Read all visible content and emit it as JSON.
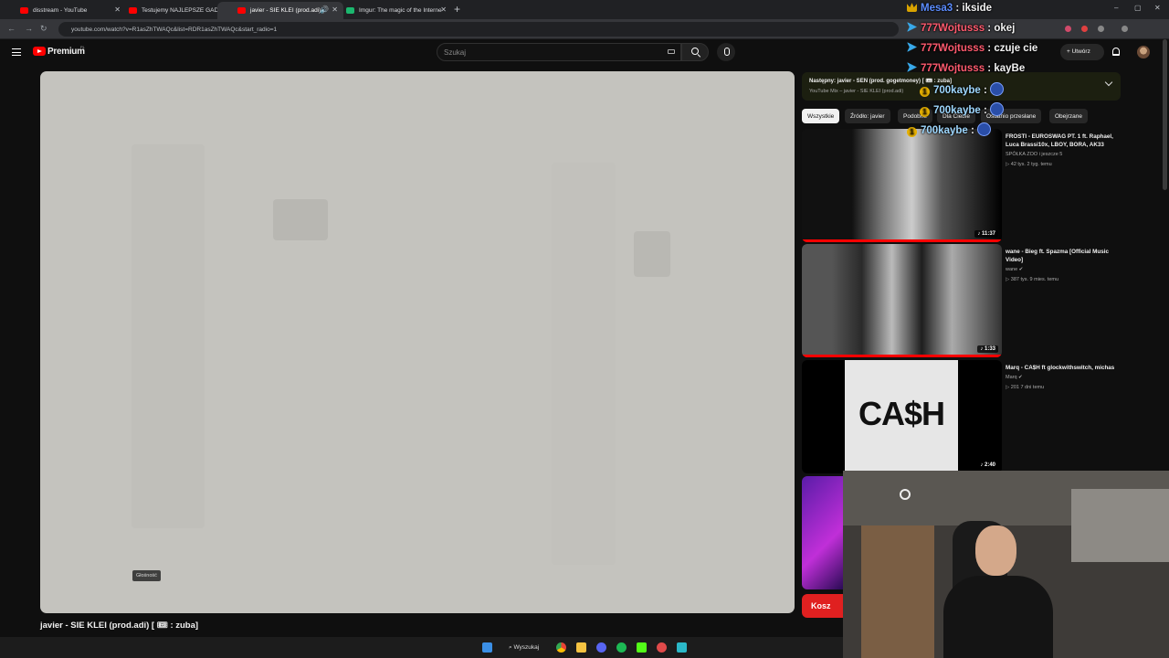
{
  "browser": {
    "tabs": [
      {
        "title": "disstream - YouTube",
        "active": false
      },
      {
        "title": "Testujemy NAJLEPSZE GADŻET",
        "active": false
      },
      {
        "title": "javier - SIE KLEI (prod.adi) | ",
        "active": true
      },
      {
        "title": "Imgur: The magic of the Interne",
        "active": false
      }
    ],
    "url": "youtube.com/watch?v=R1asZhTWAQc&list=RDR1asZhTWAQc&start_radio=1"
  },
  "youtube": {
    "logo_text": "Premium",
    "logo_region": "PL",
    "search_placeholder": "Szukaj",
    "create_label": "+ Utwórz"
  },
  "player": {
    "volume_tooltip": "Głośność",
    "video_title": "javier - SIE KLEI (prod.adi) [ 🎟 : zuba]"
  },
  "up_next": {
    "line1": "Następny: javier - SEN (prod. gogetmoney) [ 🎟 : zuba]",
    "line2": "YouTube Mix – javier - SIE KLEI (prod.adi)"
  },
  "chips": [
    "Wszystkie",
    "Źródło: javier",
    "Podobne",
    "Dla Ciebie",
    "Ostatnio przesłane",
    "Obejrzane"
  ],
  "recommendations": [
    {
      "title": "FROSTI - EUROSWAG PT. 1 ft. Raphael, Luca Brassi10x, LBOY, BORA, AK33",
      "channel": "SPÓŁKA ZOO i jeszcze 5",
      "meta": "▷ 42 tys.   2 tyg. temu",
      "duration": "♪ 11:37"
    },
    {
      "title": "wane - Bieg ft. Spazma [Official Music Video]",
      "channel": "wane ✔",
      "meta": "▷ 387 tys.   9 mies. temu",
      "duration": "♪ 1:33"
    },
    {
      "title": "Marq - CA$H ft glockwithswitch, michas",
      "channel": "Marq ✔",
      "meta": "▷ 201   7 dni temu",
      "duration": "♪ 2:40",
      "thumb_text": "CA$H"
    }
  ],
  "shop_chip": "Kosz",
  "chat": [
    {
      "user": "Mesa3",
      "message": "ikside",
      "color": "#5b8cff",
      "badge": "crown"
    },
    {
      "user": "777Wojtusss",
      "message": "okej",
      "color": "#ff5a6e",
      "badge": "prime"
    },
    {
      "user": "777Wojtusss",
      "message": "czuje cie",
      "color": "#ff5a6e",
      "badge": "prime"
    },
    {
      "user": "777Wojtusss",
      "message": "kayBe",
      "color": "#ff5a6e",
      "badge": "prime"
    },
    {
      "user": "700kaybe",
      "message": "",
      "color": "#9fd8ff",
      "badge": "coin"
    },
    {
      "user": "700kaybe",
      "message": "",
      "color": "#9fd8ff",
      "badge": "coin"
    },
    {
      "user": "700kaybe",
      "message": "",
      "color": "#9fd8ff",
      "badge": "coin"
    }
  ],
  "taskbar": {
    "search_label": "Wyszukaj"
  },
  "icons": [
    "youtube-icon",
    "speaker-icon",
    "close-icon",
    "plus-icon",
    "back-icon",
    "forward-icon",
    "reload-icon",
    "hamburger-icon",
    "keyboard-icon",
    "search-icon",
    "mic-icon",
    "bell-icon",
    "chevron-down-icon",
    "windows-start-icon",
    "chrome-icon",
    "folder-icon",
    "spotify-icon"
  ]
}
